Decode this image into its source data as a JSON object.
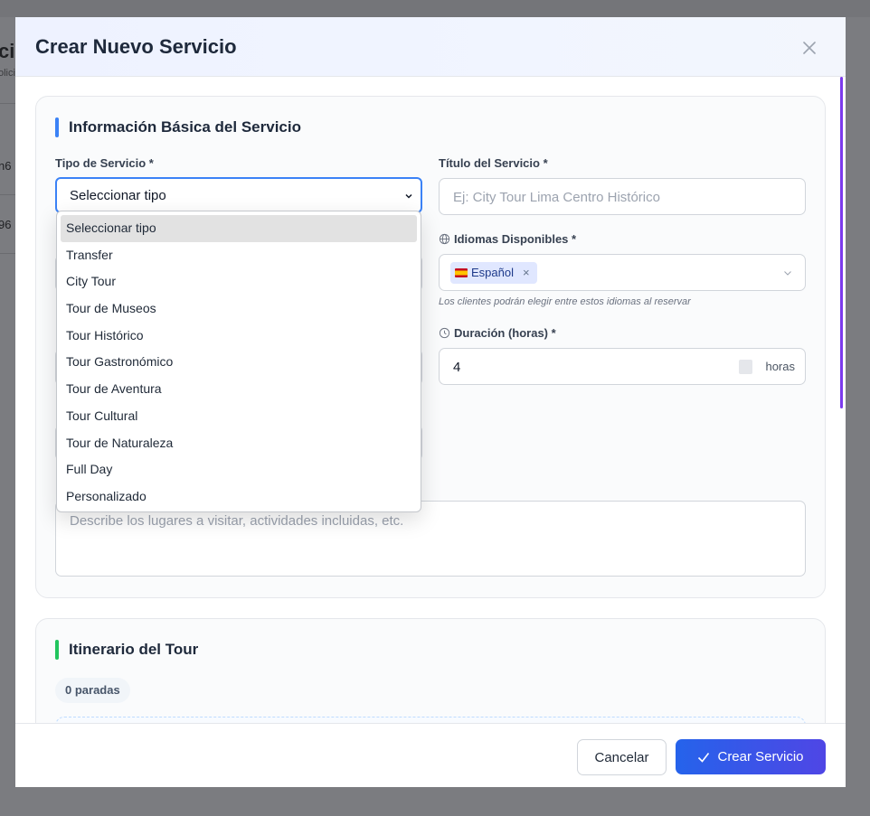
{
  "background": {
    "title_fragment": "ci",
    "subtitle_fragment": "olici",
    "row1_fragment": "n6",
    "row2_fragment": "96"
  },
  "modal": {
    "title": "Crear Nuevo Servicio"
  },
  "basic_section": {
    "heading": "Información Básica del Servicio",
    "accent_color": "#3b82f6",
    "service_type": {
      "label": "Tipo de Servicio *",
      "selected": "Seleccionar tipo",
      "options": [
        "Seleccionar tipo",
        "Transfer",
        "City Tour",
        "Tour de Museos",
        "Tour Histórico",
        "Tour Gastronómico",
        "Tour de Aventura",
        "Tour Cultural",
        "Tour de Naturaleza",
        "Full Day",
        "Personalizado"
      ]
    },
    "service_title": {
      "label": "Título del Servicio *",
      "placeholder": "Ej: City Tour Lima Centro Histórico"
    },
    "languages": {
      "label": "Idiomas Disponibles *",
      "chip": "Español",
      "help": "Los clientes podrán elegir entre estos idiomas al reservar"
    },
    "duration": {
      "label": "Duración (horas) *",
      "value": "4",
      "unit": "horas"
    },
    "description": {
      "placeholder": "Describe los lugares a visitar, actividades incluidas, etc."
    }
  },
  "itinerary_section": {
    "heading": "Itinerario del Tour",
    "accent_color": "#22c55e",
    "stops_badge": "0 paradas"
  },
  "footer": {
    "cancel_label": "Cancelar",
    "create_label": "Crear Servicio",
    "create_icon": "check-icon"
  }
}
